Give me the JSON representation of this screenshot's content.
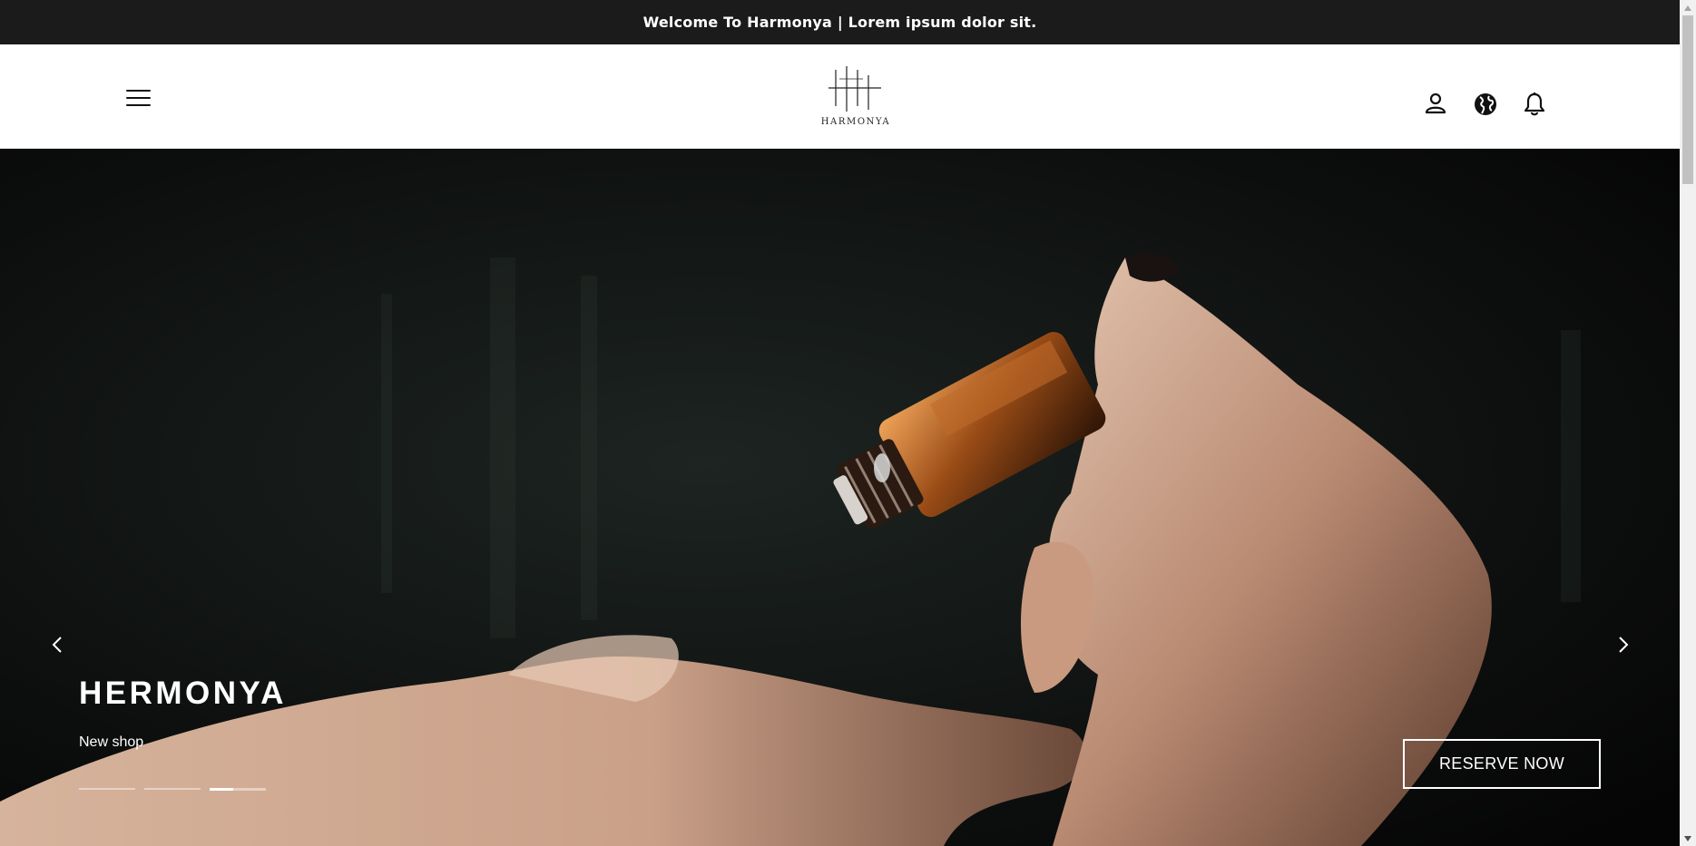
{
  "announcement": {
    "text": "Welcome To Harmonya | Lorem ipsum dolor sit."
  },
  "header": {
    "logo_text": "HARMONYA",
    "icons": [
      "menu-icon",
      "user-icon",
      "globe-icon",
      "bell-icon"
    ]
  },
  "hero": {
    "title": "HERMONYA",
    "subtitle": "New shop",
    "cta_label": "RESERVE NOW",
    "slides_total": 3,
    "active_slide": 3,
    "image": "hands-with-essential-oil-bottle"
  },
  "colors": {
    "announcement_bg": "#1b1b1b",
    "header_bg": "#ffffff",
    "hero_text": "#ffffff",
    "scrollbar_track": "#f1f1f1",
    "scrollbar_thumb": "#c1c1c1"
  }
}
